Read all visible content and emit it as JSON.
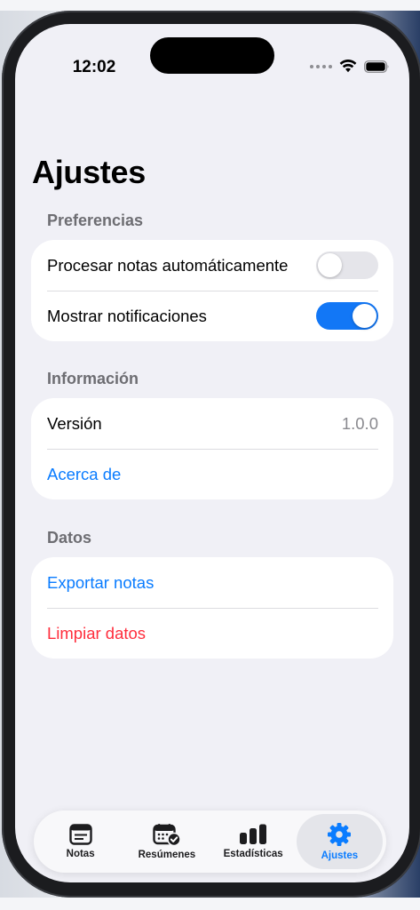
{
  "status_bar": {
    "time": "12:02"
  },
  "page": {
    "title": "Ajustes"
  },
  "sections": {
    "preferences": {
      "header": "Preferencias",
      "auto_process": {
        "label": "Procesar notas automáticamente",
        "enabled": false
      },
      "notifications": {
        "label": "Mostrar notificaciones",
        "enabled": true
      }
    },
    "info": {
      "header": "Información",
      "version_label": "Versión",
      "version_value": "1.0.0",
      "about_label": "Acerca de"
    },
    "data": {
      "header": "Datos",
      "export_label": "Exportar notas",
      "clear_label": "Limpiar datos"
    }
  },
  "tab_bar": {
    "tabs": [
      {
        "label": "Notas",
        "icon": "notes-icon",
        "active": false
      },
      {
        "label": "Resúmenes",
        "icon": "calendar-check-icon",
        "active": false
      },
      {
        "label": "Estadísticas",
        "icon": "bar-chart-icon",
        "active": false
      },
      {
        "label": "Ajustes",
        "icon": "gear-icon",
        "active": true
      }
    ]
  },
  "colors": {
    "accent": "#0a7cff",
    "destructive": "#ff2d3c",
    "toggle_on": "#1277f6",
    "background": "#f0f0f6"
  }
}
